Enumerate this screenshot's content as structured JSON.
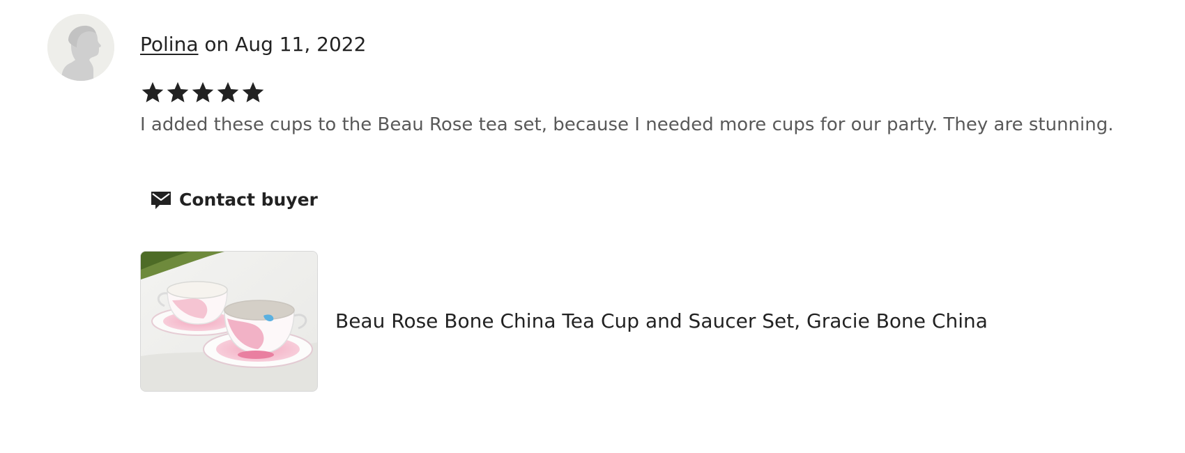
{
  "review": {
    "reviewer_name": "Polina",
    "date_text": " on Aug 11, 2022",
    "rating": 5,
    "rating_max": 5,
    "text": "I added these cups to the Beau Rose tea set, because I needed more cups for our party. They are stunning.",
    "contact_label": "Contact buyer",
    "listing_title": "Beau Rose Bone China Tea Cup and Saucer Set, Gracie Bone China"
  },
  "icons": {
    "avatar": "default-profile-silhouette",
    "star": "star-icon",
    "contact": "envelope-message-icon"
  },
  "colors": {
    "text_primary": "#222222",
    "text_secondary": "#595959",
    "avatar_bg": "#eeeeea",
    "silhouette": "#cfcfcf"
  }
}
